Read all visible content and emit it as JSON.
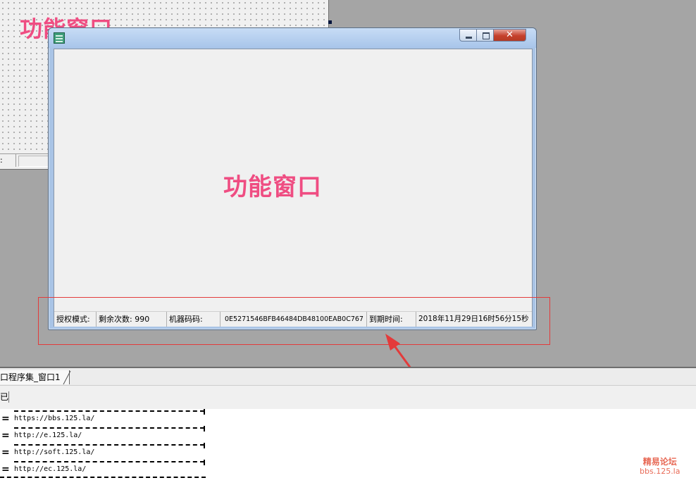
{
  "background_form": {
    "title": "功能窗口",
    "status_fragment": ":"
  },
  "window": {
    "content_title": "功能窗口",
    "status_bar": {
      "auth_mode_label": "授权模式:",
      "remaining_label": "剩余次数: 990",
      "machine_code_label": "机器码码:",
      "machine_code_value": "0E5271546BFB46484DB48100EAB0C767",
      "expire_label": "到期时间:",
      "expire_value": "2018年11月29日16时56分15秒"
    }
  },
  "ide": {
    "tab_label": "口程序集_窗口1",
    "toolrow_fragment": "已",
    "code_lines": [
      {
        "eq": "=",
        "url": "https://bbs.125.la/"
      },
      {
        "eq": "=",
        "url": "http://e.125.la/"
      },
      {
        "eq": "=",
        "url": "http://soft.125.la/"
      },
      {
        "eq": "=",
        "url": "http://ec.125.la/"
      }
    ]
  },
  "watermark": {
    "line1": "精易论坛",
    "line2": "bbs.125.la"
  },
  "colors": {
    "title_pink": "#ef4d82",
    "annotation_red": "#e33b3b"
  }
}
